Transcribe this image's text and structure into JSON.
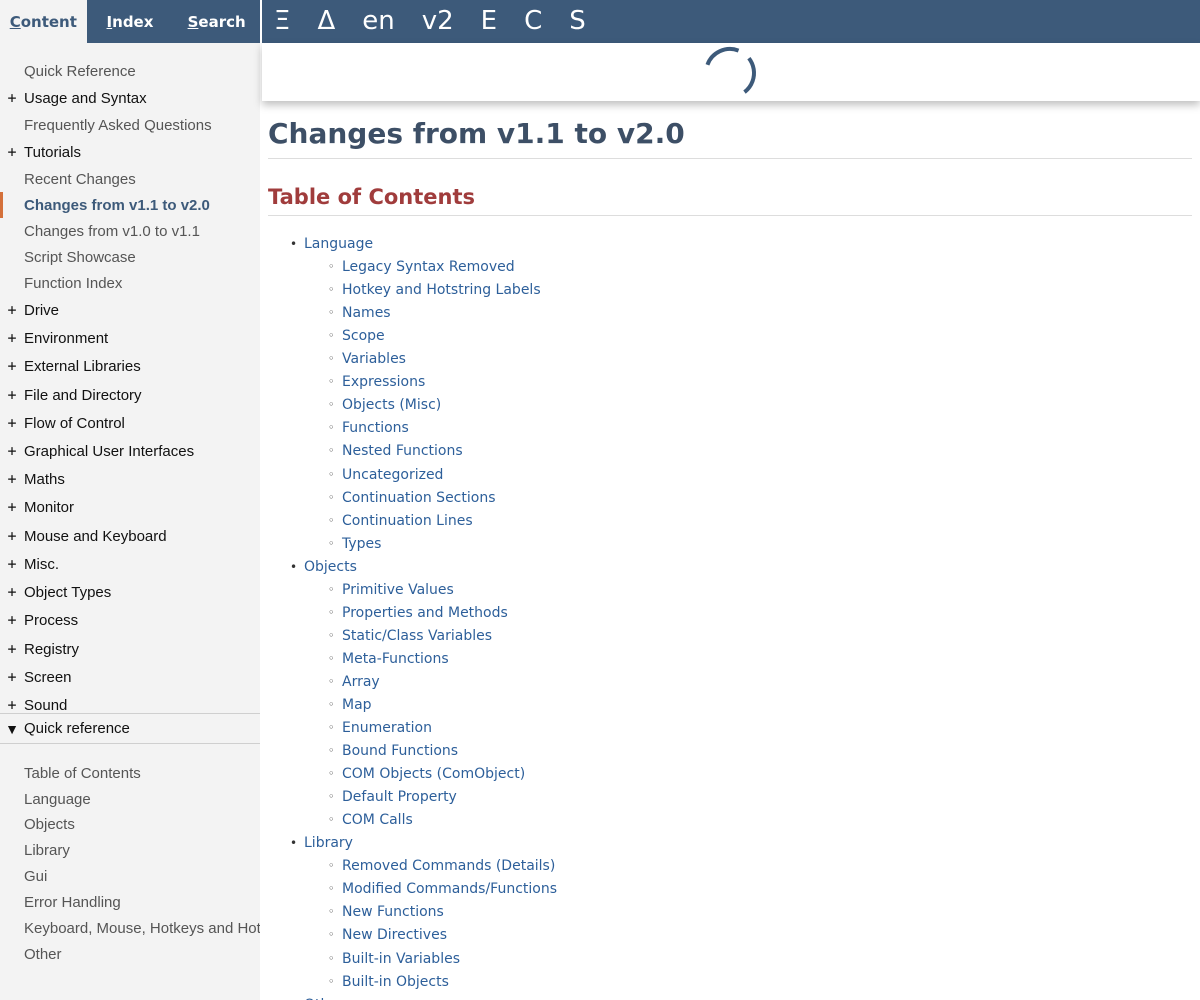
{
  "tabs": [
    {
      "pre": "",
      "key": "C",
      "post": "ontent",
      "active": true
    },
    {
      "pre": "",
      "key": "I",
      "post": "ndex",
      "active": false
    },
    {
      "pre": "",
      "key": "S",
      "post": "earch",
      "active": false
    }
  ],
  "sidebar": {
    "items": [
      {
        "label": "Quick Reference",
        "expandable": false
      },
      {
        "label": "Usage and Syntax",
        "expandable": true
      },
      {
        "label": "Frequently Asked Questions",
        "expandable": false
      },
      {
        "label": "Tutorials",
        "expandable": true
      },
      {
        "label": "Recent Changes",
        "expandable": false
      },
      {
        "label": "Changes from v1.1 to v2.0",
        "expandable": false,
        "active": true
      },
      {
        "label": "Changes from v1.0 to v1.1",
        "expandable": false
      },
      {
        "label": "Script Showcase",
        "expandable": false
      },
      {
        "label": "Function Index",
        "expandable": false
      },
      {
        "label": "Drive",
        "expandable": true
      },
      {
        "label": "Environment",
        "expandable": true
      },
      {
        "label": "External Libraries",
        "expandable": true
      },
      {
        "label": "File and Directory",
        "expandable": true
      },
      {
        "label": "Flow of Control",
        "expandable": true
      },
      {
        "label": "Graphical User Interfaces",
        "expandable": true
      },
      {
        "label": "Maths",
        "expandable": true
      },
      {
        "label": "Monitor",
        "expandable": true
      },
      {
        "label": "Mouse and Keyboard",
        "expandable": true
      },
      {
        "label": "Misc.",
        "expandable": true
      },
      {
        "label": "Object Types",
        "expandable": true
      },
      {
        "label": "Process",
        "expandable": true
      },
      {
        "label": "Registry",
        "expandable": true
      },
      {
        "label": "Screen",
        "expandable": true
      },
      {
        "label": "Sound",
        "expandable": true
      }
    ],
    "plus_glyph": "+"
  },
  "quick_reference": {
    "header": "Quick reference",
    "toggle_glyph": "▼",
    "items": [
      "Table of Contents",
      "Language",
      "Objects",
      "Library",
      "Gui",
      "Error Handling",
      "Keyboard, Mouse, Hotkeys and Hotstrings",
      "Other"
    ]
  },
  "toolbar": {
    "buttons": [
      {
        "glyph": "Ξ",
        "name": "sidebar-toggle-button"
      },
      {
        "glyph": "Δ",
        "name": "settings-button"
      },
      {
        "glyph": "en",
        "name": "language-button"
      },
      {
        "glyph": "v2",
        "name": "version-button"
      },
      {
        "glyph": "E",
        "name": "edit-button"
      },
      {
        "glyph": "C",
        "name": "collapse-button"
      },
      {
        "glyph": "S",
        "name": "scroll-button"
      }
    ]
  },
  "main": {
    "title": "Changes from v1.1 to v2.0",
    "toc_heading": "Table of Contents",
    "bullet_l1": "•",
    "bullet_l2": "◦",
    "toc": [
      {
        "label": "Language",
        "children": [
          "Legacy Syntax Removed",
          "Hotkey and Hotstring Labels",
          "Names",
          "Scope",
          "Variables",
          "Expressions",
          "Objects (Misc)",
          "Functions",
          "Nested Functions",
          "Uncategorized",
          "Continuation Sections",
          "Continuation Lines",
          "Types"
        ]
      },
      {
        "label": "Objects",
        "children": [
          "Primitive Values",
          "Properties and Methods",
          "Static/Class Variables",
          "Meta-Functions",
          "Array",
          "Map",
          "Enumeration",
          "Bound Functions",
          "COM Objects (ComObject)",
          "Default Property",
          "COM Calls"
        ]
      },
      {
        "label": "Library",
        "children": [
          "Removed Commands (Details)",
          "Modified Commands/Functions",
          "New Functions",
          "New Directives",
          "Built-in Variables",
          "Built-in Objects"
        ]
      },
      {
        "label": "Other",
        "children": []
      }
    ]
  },
  "colors": {
    "accent": "#3d5a7a",
    "active_marker": "#d4703a",
    "link": "#2d5f9a",
    "toc_heading": "#a03c3c"
  }
}
